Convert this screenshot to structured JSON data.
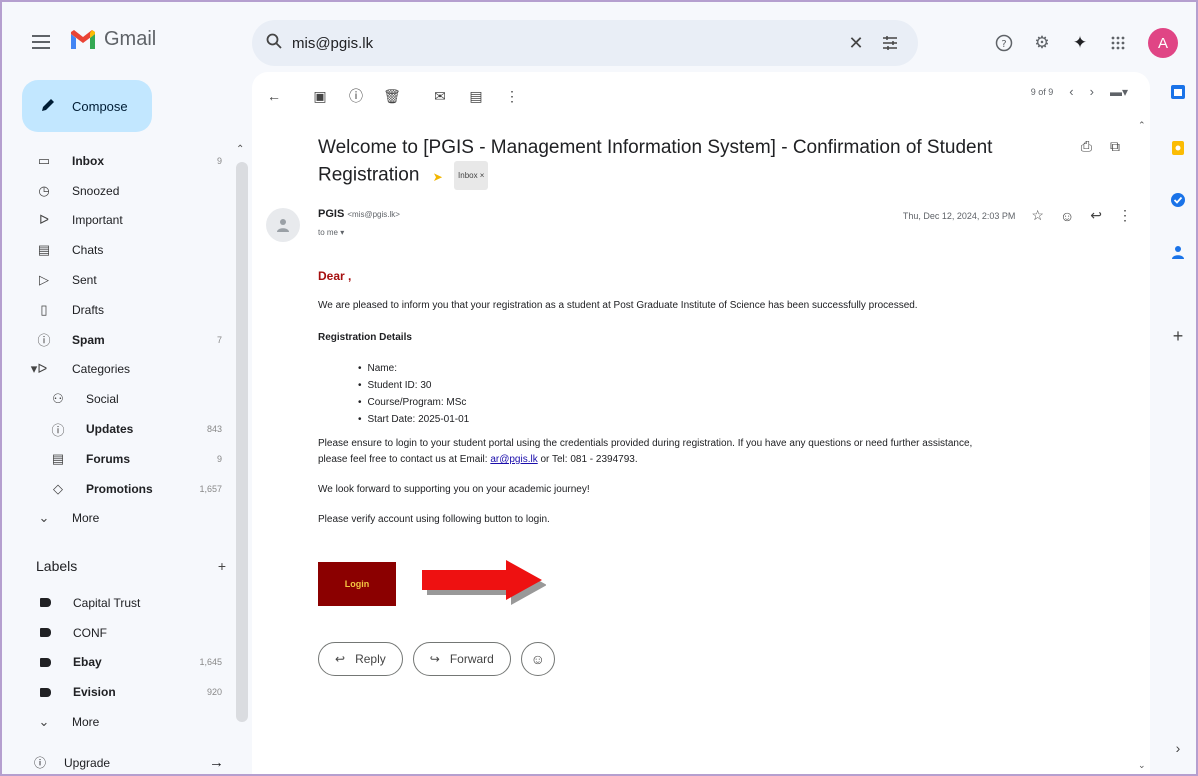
{
  "app": {
    "name": "Gmail",
    "avatar_letter": "A",
    "accent": "#c2e7ff"
  },
  "search": {
    "value": "mis@pgis.lk"
  },
  "sidebar": {
    "compose_label": "Compose",
    "items": [
      {
        "label": "Inbox",
        "count": "9",
        "icon": "inbox-icon",
        "bold": true
      },
      {
        "label": "Snoozed",
        "count": "",
        "icon": "clock-icon",
        "bold": false
      },
      {
        "label": "Important",
        "count": "",
        "icon": "important-icon",
        "bold": false
      },
      {
        "label": "Chats",
        "count": "",
        "icon": "chat-icon",
        "bold": false
      },
      {
        "label": "Sent",
        "count": "",
        "icon": "send-icon",
        "bold": false
      },
      {
        "label": "Drafts",
        "count": "",
        "icon": "draft-icon",
        "bold": false
      },
      {
        "label": "Spam",
        "count": "7",
        "icon": "spam-icon",
        "bold": true
      },
      {
        "label": "Categories",
        "count": "",
        "icon": "label-icon",
        "bold": false
      },
      {
        "label": "Social",
        "count": "",
        "icon": "people-icon",
        "bold": false,
        "sub": true
      },
      {
        "label": "Updates",
        "count": "843",
        "icon": "info-icon",
        "bold": true,
        "sub": true
      },
      {
        "label": "Forums",
        "count": "9",
        "icon": "forum-icon",
        "bold": true,
        "sub": true
      },
      {
        "label": "Promotions",
        "count": "1,657",
        "icon": "tag-icon",
        "bold": true,
        "sub": true
      },
      {
        "label": "More",
        "count": "",
        "icon": "chevron-down-icon",
        "bold": false
      }
    ],
    "labels_heading": "Labels",
    "labels": [
      {
        "label": "Capital Trust",
        "count": "",
        "bold": false
      },
      {
        "label": "CONF",
        "count": "",
        "bold": false
      },
      {
        "label": "Ebay",
        "count": "1,645",
        "bold": true
      },
      {
        "label": "Evision",
        "count": "920",
        "bold": true
      },
      {
        "label": "More",
        "count": "",
        "bold": false
      }
    ],
    "upgrade_label": "Upgrade"
  },
  "pager": {
    "text": "9 of 9"
  },
  "email": {
    "subject": "Welcome to [PGIS - Management Information System] - Confirmation of Student Registration",
    "tag": "Inbox ×",
    "sender_name": "PGIS",
    "sender_email": "<mis@pgis.lk>",
    "to": "to me ▾",
    "date": "Thu, Dec 12, 2024, 2:03 PM",
    "greeting": "Dear ,",
    "intro": "We are pleased to inform you that your registration as a student at Post Graduate Institute of Science has been successfully processed.",
    "details_heading": "Registration Details",
    "details": [
      "Name:",
      "Student ID: 30",
      "Course/Program: MSc",
      "Start Date: 2025-01-01"
    ],
    "ensure_text_1": "Please ensure to login to your student portal using the credentials provided during registration. If you have any questions or need further assistance,",
    "ensure_text_2": "please feel free to contact us at Email: ",
    "contact_email": "ar@pgis.lk",
    "ensure_text_3": " or Tel: 081 - 2394793.",
    "look_forward": "We look forward to supporting you on your academic journey!",
    "verify_text": "Please verify account using following button to login.",
    "login_label": "Login",
    "reply_label": "Reply",
    "forward_label": "Forward"
  }
}
